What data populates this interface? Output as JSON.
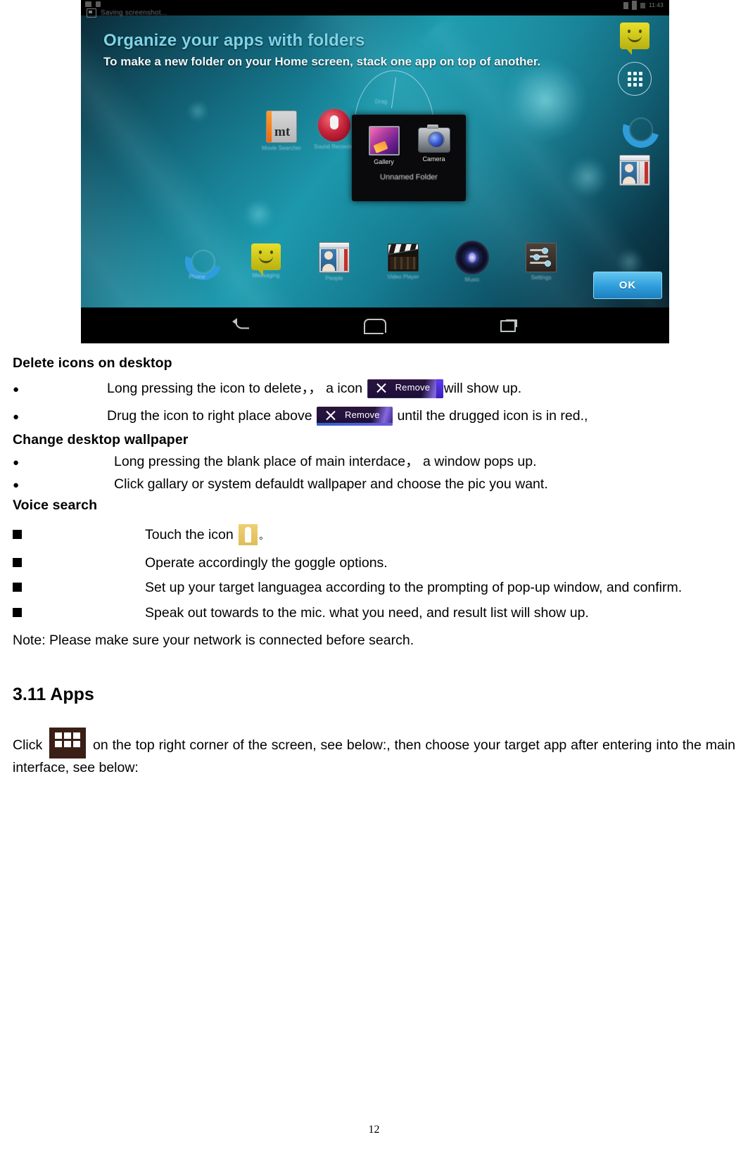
{
  "figure": {
    "status_bar": {
      "time": "11:43",
      "notification_text": "Saving screenshot..."
    },
    "tip": {
      "title": "Organize your apps with folders",
      "subtitle": "To make a new folder on your Home screen, stack one app on top of another."
    },
    "folder_popup": {
      "apps": [
        {
          "label": "Gallery",
          "icon": "gallery-icon"
        },
        {
          "label": "Camera",
          "icon": "camera-icon"
        }
      ],
      "folder_name": "Unnamed Folder"
    },
    "lasso_label": "Drag",
    "home_icons": [
      {
        "label": "Movie Searcher",
        "icon": "mt-app-icon"
      },
      {
        "label": "Sound Recorder",
        "icon": "sound-recorder-icon"
      },
      {
        "label": "Phone",
        "icon": "phone-icon"
      },
      {
        "label": "Messaging",
        "icon": "messaging-icon"
      },
      {
        "label": "People",
        "icon": "people-icon"
      },
      {
        "label": "Video Player",
        "icon": "video-player-icon"
      },
      {
        "label": "Music",
        "icon": "music-icon"
      },
      {
        "label": "Settings",
        "icon": "settings-icon"
      }
    ],
    "dock_right": [
      {
        "icon": "messaging-icon"
      },
      {
        "icon": "apps-grid-icon"
      },
      {
        "icon": "phone-icon"
      },
      {
        "icon": "people-icon"
      }
    ],
    "ok_button": "OK",
    "nav_bar": [
      {
        "icon": "back-icon"
      },
      {
        "icon": "home-icon"
      },
      {
        "icon": "recent-apps-icon"
      }
    ]
  },
  "document": {
    "headings": {
      "delete_icons": "Delete icons on desktop",
      "change_wallpaper": "Change desktop wallpaper",
      "voice_search": "Voice search",
      "section_apps": "3.11 Apps"
    },
    "delete_icons_bullets": [
      {
        "bullet": "●",
        "before": "Long pressing the icon to delete，， a icon",
        "badge": "Remove",
        "after": "will show up."
      },
      {
        "bullet": "●",
        "before": "Drug the icon to right place above",
        "badge": "Remove",
        "after": "until the drugged icon is in red.,"
      }
    ],
    "wallpaper_bullets": [
      {
        "bullet": "●",
        "text": "Long pressing the blank place of main interdace，  a window pops up."
      },
      {
        "bullet": "●",
        "text": "Click gallary or system defauldt wallpaper and choose the pic you want."
      }
    ],
    "voice_search_bullets": [
      {
        "bullet": "■",
        "before": "Touch the icon",
        "badge": "mic-icon",
        "after": "。"
      },
      {
        "bullet": "■",
        "text": "Operate accordingly the goggle options."
      },
      {
        "bullet": "■",
        "text": " Set up your target languagea according to the prompting of pop-up window, and confirm."
      },
      {
        "bullet": "■",
        "text": "Speak out towards to the mic. what you need, and result list will show up."
      }
    ],
    "note": "Note: Please make sure your network is connected before search.",
    "apps_paragraph": {
      "before": "Click",
      "badge": "apps-grid-icon",
      "after": "on the top right corner of the screen, see below:,   then choose your target app after entering into the main interface, see below:"
    },
    "page_number": "12"
  }
}
